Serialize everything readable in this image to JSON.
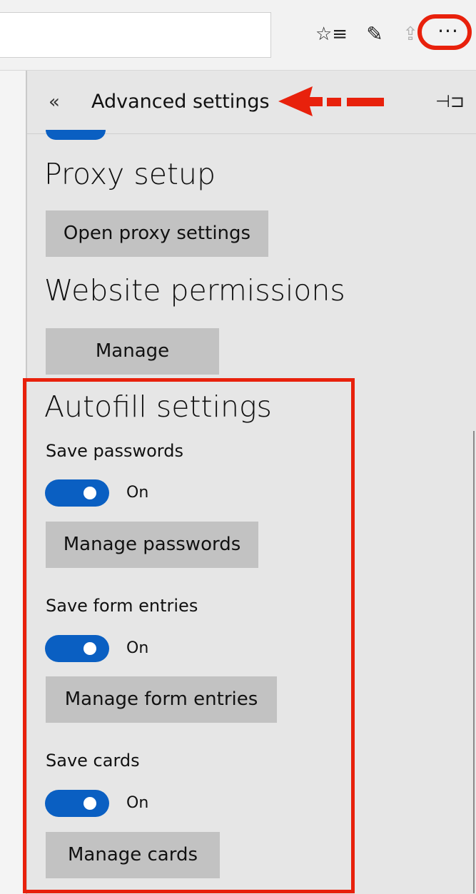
{
  "panel": {
    "title": "Advanced settings"
  },
  "proxy": {
    "heading": "Proxy setup",
    "button": "Open proxy settings"
  },
  "permissions": {
    "heading": "Website permissions",
    "button": "Manage"
  },
  "autofill": {
    "heading": "Autofill settings",
    "passwords": {
      "label": "Save passwords",
      "state": "On",
      "button": "Manage passwords"
    },
    "forms": {
      "label": "Save form entries",
      "state": "On",
      "button": "Manage form entries"
    },
    "cards": {
      "label": "Save cards",
      "state": "On",
      "button": "Manage cards"
    }
  },
  "icons": {
    "favorites": "star-list-icon",
    "notes": "pen-icon",
    "share": "share-icon",
    "more": "more-icon",
    "back": "double-chevron-left-icon",
    "pin": "pin-icon"
  },
  "colors": {
    "accent": "#0a5fc2",
    "annotation": "#e8210c",
    "button": "#c2c2c2",
    "panel": "#e6e6e6"
  }
}
